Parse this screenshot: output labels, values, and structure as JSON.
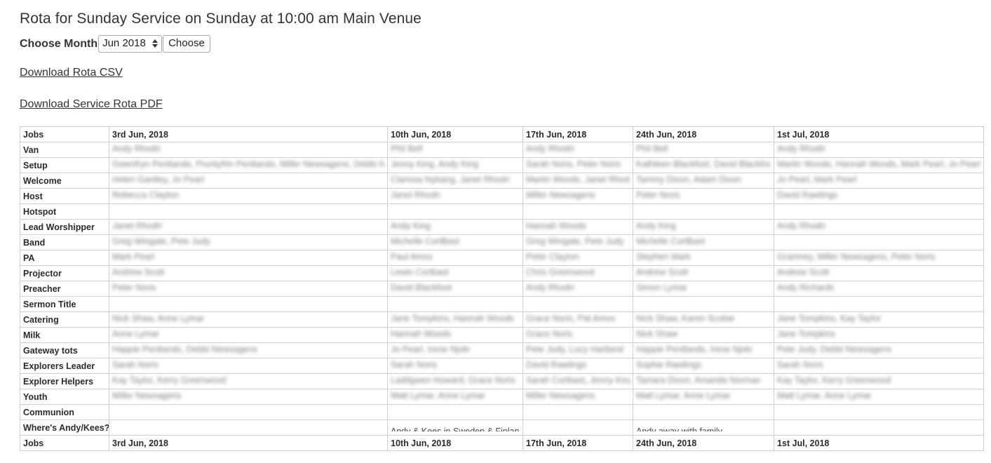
{
  "header": {
    "title": "Rota for Sunday Service on Sunday at 10:00 am Main Venue"
  },
  "controls": {
    "choose_month_label": "Choose Month",
    "month_value": "Jun 2018",
    "month_options": [
      "Jun 2018"
    ],
    "choose_button": "Choose",
    "csv_link": "Download Rota CSV",
    "pdf_link": "Download Service Rota PDF"
  },
  "table": {
    "columns": [
      "Jobs",
      "3rd Jun, 2018",
      "10th Jun, 2018",
      "17th Jun, 2018",
      "24th Jun, 2018",
      "1st Jul, 2018"
    ],
    "footer_columns": [
      "Jobs",
      "3rd Jun, 2018",
      "10th Jun, 2018",
      "17th Jun, 2018",
      "24th Jun, 2018",
      "1st Jul, 2018"
    ],
    "rows": [
      {
        "job": "Van",
        "redacted": true,
        "cells": [
          "Andy Rhodri",
          "Phil Bell",
          "Andy Rhodri",
          "Phil Bell",
          "Andy Rhodri"
        ]
      },
      {
        "job": "Setup",
        "redacted": true,
        "cells": [
          "Gwenfryn Pentlands, Pruntyfrin Pentlands, Miller Newsagens, Debbi Newsagens",
          "Jenny King, Andy King",
          "Sarah Noris, Peter Noris",
          "Kathleen Blackfoot, David Blackfoot",
          "Martin Woods, Hannah Woods, Mark Pearl, Jo Pearl"
        ]
      },
      {
        "job": "Welcome",
        "redacted": true,
        "cells": [
          "Helen Gantley, Jo Pearl",
          "Clarissa Nybang, Janet Rhodri",
          "Martin Woods, Janet Rhodri",
          "Tammy Dixon, Adam Dixon",
          "Jo Pearl, Mark Pearl"
        ]
      },
      {
        "job": "Host",
        "redacted": true,
        "cells": [
          "Rebecca Clayton",
          "Janet Rhodri",
          "Miller Newsagens",
          "Peter Noris",
          "David Rawlings"
        ]
      },
      {
        "job": "Hotspot",
        "redacted": true,
        "cells": [
          "",
          "",
          "",
          "",
          ""
        ]
      },
      {
        "job": "Lead Worshipper",
        "redacted": true,
        "cells": [
          "Janet Rhodri",
          "Andy King",
          "Hannah Woods",
          "Andy King",
          "Andy Rhodri"
        ]
      },
      {
        "job": "Band",
        "redacted": true,
        "cells": [
          "Greg Wingate, Pete Judy",
          "Michelle CortBast",
          "Greg Wingate, Pete Judy",
          "Michelle CortBast",
          ""
        ]
      },
      {
        "job": "PA",
        "redacted": true,
        "cells": [
          "Mark Pearl",
          "Paul Amos",
          "Peter Clayton",
          "Stephen Mark",
          "Gramney, Miller Newsagens, Peter Noris"
        ]
      },
      {
        "job": "Projector",
        "redacted": true,
        "cells": [
          "Andrew Scott",
          "Lewis Cortbast",
          "Chris Greenwood",
          "Andrew Scott",
          "Andrew Scott"
        ]
      },
      {
        "job": "Preacher",
        "redacted": true,
        "cells": [
          "Peter Noris",
          "David Blackfoot",
          "Andy Rhodri",
          "Simon Lymar",
          "Andy Richards"
        ]
      },
      {
        "job": "Sermon Title",
        "redacted": true,
        "cells": [
          "",
          "",
          "",
          "",
          ""
        ]
      },
      {
        "job": "Catering",
        "redacted": true,
        "cells": [
          "Nick Shaw, Anne Lymar",
          "Jane Tompkins, Hannah Woods",
          "Grace Noris, Pat Amos",
          "Nick Shaw, Karen Scobie",
          "Jane Tompkins, Kay Taylor"
        ]
      },
      {
        "job": "Milk",
        "redacted": true,
        "cells": [
          "Anne Lymar",
          "Hannah Woods",
          "Grace Noris",
          "Nick Shaw",
          "Jane Tompkins"
        ]
      },
      {
        "job": "Gateway tots",
        "redacted": true,
        "cells": [
          "Happie Pentlands, Debbi Newsagens",
          "Jo Pearl, Irene Njoki",
          "Pete Judy, Lucy Hartland",
          "Happie Pentlands, Irene Njoki",
          "Pete Judy, Debbi Newsagens"
        ]
      },
      {
        "job": "Explorers Leader",
        "redacted": true,
        "cells": [
          "Sarah Noris",
          "Sarah Noris",
          "David Rawlings",
          "Sophie Rawlings",
          "Sarah Noris"
        ]
      },
      {
        "job": "Explorer Helpers",
        "redacted": true,
        "cells": [
          "Kay Taylor, Kerry Greenwood",
          "Laddgwen Howard, Grace Noris",
          "Sarah Cortbast, Jenny King",
          "Tamara Dixon, Amanda Norman",
          "Kay Taylor, Kerry Greenwood"
        ]
      },
      {
        "job": "Youth",
        "redacted": true,
        "cells": [
          "Miller Newsagens",
          "Matt Lymar, Anne Lymar",
          "Miller Newsagens",
          "Matt Lymar, Anne Lymar",
          "Matt Lymar, Anne Lymar"
        ]
      },
      {
        "job": "Communion",
        "redacted": true,
        "cells": [
          "",
          "",
          "",
          "",
          ""
        ]
      },
      {
        "job": "Where's Andy/Kees?",
        "redacted": false,
        "cells": [
          "",
          "Andy & Kees in Sweden & Finland",
          "",
          "Andy away with family",
          ""
        ]
      }
    ]
  }
}
